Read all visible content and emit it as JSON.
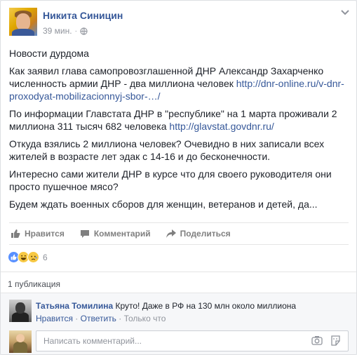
{
  "post": {
    "author": "Никита Синицин",
    "time": "39 мин.",
    "dot": "·",
    "paragraphs": [
      {
        "text": "Новости дурдома",
        "link": ""
      },
      {
        "text": "Как заявил глава самопровозглашенной ДНР Александр Захарченко численность армии ДНР - два миллиона человек ",
        "link": "http://dnr-online.ru/v-dnr-proxodyat-mobilizacionnyj-sbor-…/"
      },
      {
        "text": "По информации Главстата ДНР в \"республике\" на 1 марта проживали 2 миллиона 311 тысяч 682 человека ",
        "link": "http://glavstat.govdnr.ru/"
      },
      {
        "text": "Откуда взялись 2 миллиона человек? Очевидно в них записали всех жителей в возрасте лет эдак с 14-16 и до бесконечности.",
        "link": ""
      },
      {
        "text": "Интересно сами жители ДНР в курсе что для своего руководителя они просто пушечное мясо?",
        "link": ""
      },
      {
        "text": "Будем ждать военных сборов для женщин, ветеранов и детей, да...",
        "link": ""
      }
    ]
  },
  "actions": {
    "like": "Нравится",
    "comment": "Комментарий",
    "share": "Поделиться"
  },
  "reactions": {
    "icons": [
      "like-reaction-icon",
      "haha-reaction-icon",
      "sad-reaction-icon"
    ],
    "count": "6"
  },
  "shares": "1 публикация",
  "comment": {
    "author": "Татьяна Томилина",
    "text": "Круто! Даже в РФ на 130 млн около миллиона",
    "like_label": "Нравится",
    "reply_label": "Ответить",
    "time": "Только что",
    "sep": "·"
  },
  "comment_input": {
    "placeholder": "Написать комментарий..."
  },
  "colors": {
    "link": "#365899",
    "muted": "#90949c",
    "background": "#e9ebee"
  }
}
